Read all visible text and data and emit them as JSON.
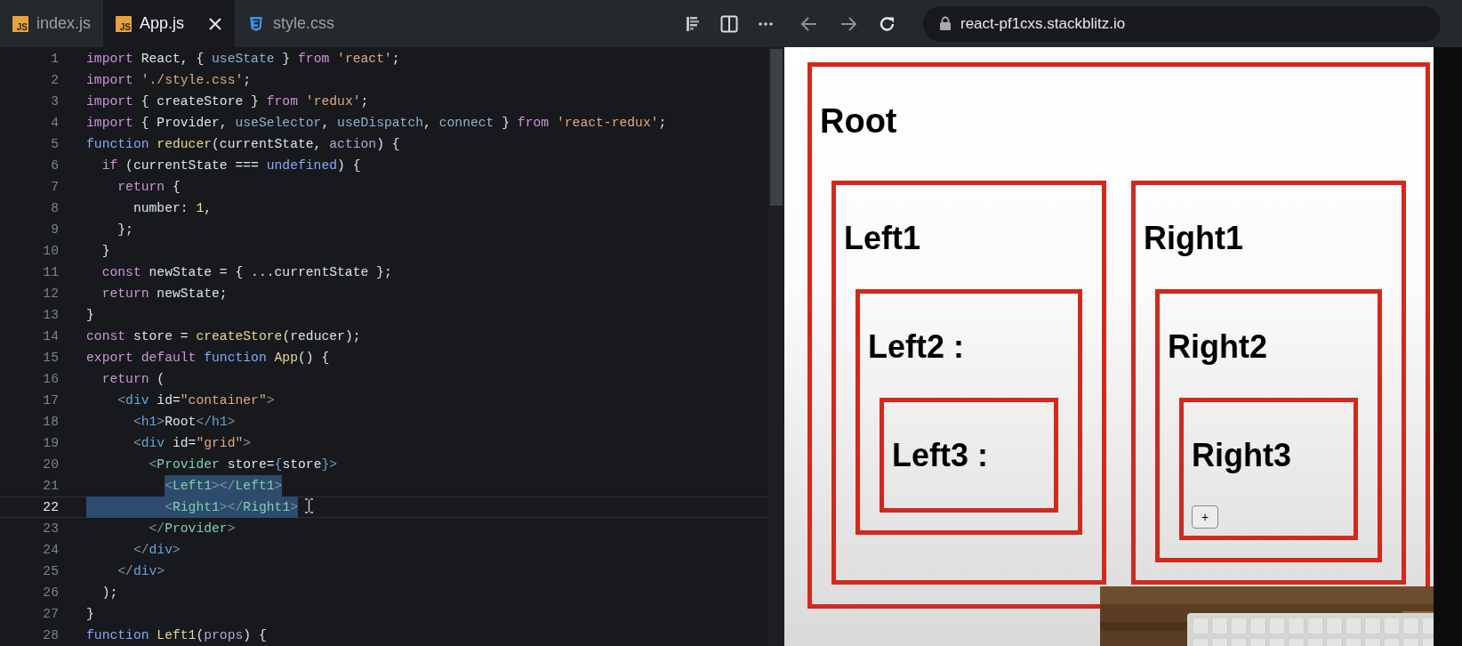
{
  "editor": {
    "tabs": [
      {
        "label": "index.js",
        "kind": "js",
        "badge": "JS",
        "selected": false
      },
      {
        "label": "App.js",
        "kind": "js",
        "badge": "JS",
        "selected": true
      },
      {
        "label": "style.css",
        "kind": "css",
        "selected": false
      }
    ],
    "lines": [
      {
        "number": "1",
        "selected": false,
        "current": false,
        "tokens": [
          {
            "text": "import",
            "kind": "keyword"
          },
          {
            "text": " React, { ",
            "kind": "plain"
          },
          {
            "text": "useState",
            "kind": "import"
          },
          {
            "text": " } ",
            "kind": "plain"
          },
          {
            "text": "from",
            "kind": "keyword"
          },
          {
            "text": " 'react'",
            "kind": "string"
          },
          {
            "text": ";",
            "kind": "plain"
          }
        ]
      },
      {
        "number": "2",
        "selected": false,
        "current": false,
        "tokens": [
          {
            "text": "import",
            "kind": "keyword"
          },
          {
            "text": " './style.css'",
            "kind": "string"
          },
          {
            "text": ";",
            "kind": "plain"
          }
        ]
      },
      {
        "number": "3",
        "selected": false,
        "current": false,
        "tokens": [
          {
            "text": "import",
            "kind": "keyword"
          },
          {
            "text": " { createStore } ",
            "kind": "plain"
          },
          {
            "text": "from",
            "kind": "keyword"
          },
          {
            "text": " 'redux'",
            "kind": "string"
          },
          {
            "text": ";",
            "kind": "plain"
          }
        ]
      },
      {
        "number": "4",
        "selected": false,
        "current": false,
        "tokens": [
          {
            "text": "import",
            "kind": "keyword"
          },
          {
            "text": " { Provider, ",
            "kind": "plain"
          },
          {
            "text": "useSelector",
            "kind": "import"
          },
          {
            "text": ", ",
            "kind": "plain"
          },
          {
            "text": "useDispatch",
            "kind": "import"
          },
          {
            "text": ", ",
            "kind": "plain"
          },
          {
            "text": "connect",
            "kind": "import"
          },
          {
            "text": " } ",
            "kind": "plain"
          },
          {
            "text": "from",
            "kind": "keyword"
          },
          {
            "text": " 'react-redux'",
            "kind": "string"
          },
          {
            "text": ";",
            "kind": "plain"
          }
        ]
      },
      {
        "number": "5",
        "selected": false,
        "current": false,
        "tokens": [
          {
            "text": "function",
            "kind": "storage"
          },
          {
            "text": " reducer",
            "kind": "func"
          },
          {
            "text": "(currentState, ",
            "kind": "plain"
          },
          {
            "text": "action",
            "kind": "param"
          },
          {
            "text": ") {",
            "kind": "plain"
          }
        ]
      },
      {
        "number": "6",
        "selected": false,
        "current": false,
        "tokens": [
          {
            "text": "  if",
            "kind": "keyword"
          },
          {
            "text": " (currentState === ",
            "kind": "plain"
          },
          {
            "text": "undefined",
            "kind": "constant"
          },
          {
            "text": ") {",
            "kind": "plain"
          }
        ]
      },
      {
        "number": "7",
        "selected": false,
        "current": false,
        "tokens": [
          {
            "text": "    return",
            "kind": "keyword"
          },
          {
            "text": " {",
            "kind": "plain"
          }
        ]
      },
      {
        "number": "8",
        "selected": false,
        "current": false,
        "tokens": [
          {
            "text": "      number: ",
            "kind": "plain"
          },
          {
            "text": "1",
            "kind": "number"
          },
          {
            "text": ",",
            "kind": "plain"
          }
        ]
      },
      {
        "number": "9",
        "selected": false,
        "current": false,
        "tokens": [
          {
            "text": "    };",
            "kind": "plain"
          }
        ]
      },
      {
        "number": "10",
        "selected": false,
        "current": false,
        "tokens": [
          {
            "text": "  }",
            "kind": "plain"
          }
        ]
      },
      {
        "number": "11",
        "selected": false,
        "current": false,
        "tokens": [
          {
            "text": "  const",
            "kind": "keyword"
          },
          {
            "text": " newState = { ...currentState };",
            "kind": "plain"
          }
        ]
      },
      {
        "number": "12",
        "selected": false,
        "current": false,
        "tokens": [
          {
            "text": "  return",
            "kind": "keyword"
          },
          {
            "text": " newState;",
            "kind": "plain"
          }
        ]
      },
      {
        "number": "13",
        "selected": false,
        "current": false,
        "tokens": [
          {
            "text": "}",
            "kind": "plain"
          }
        ]
      },
      {
        "number": "14",
        "selected": false,
        "current": false,
        "tokens": [
          {
            "text": "const",
            "kind": "keyword"
          },
          {
            "text": " store = ",
            "kind": "plain"
          },
          {
            "text": "createStore",
            "kind": "func"
          },
          {
            "text": "(reducer);",
            "kind": "plain"
          }
        ]
      },
      {
        "number": "15",
        "selected": false,
        "current": false,
        "tokens": [
          {
            "text": "export default",
            "kind": "keyword"
          },
          {
            "text": " function",
            "kind": "storage"
          },
          {
            "text": " App",
            "kind": "func"
          },
          {
            "text": "() {",
            "kind": "plain"
          }
        ]
      },
      {
        "number": "16",
        "selected": false,
        "current": false,
        "tokens": [
          {
            "text": "  return",
            "kind": "keyword"
          },
          {
            "text": " (",
            "kind": "plain"
          }
        ]
      },
      {
        "number": "17",
        "selected": false,
        "current": false,
        "tokens": [
          {
            "text": "    <",
            "kind": "tagpunct"
          },
          {
            "text": "div",
            "kind": "htmltag"
          },
          {
            "text": " id=",
            "kind": "plain"
          },
          {
            "text": "\"container\"",
            "kind": "string"
          },
          {
            "text": ">",
            "kind": "tagpunct"
          }
        ]
      },
      {
        "number": "18",
        "selected": false,
        "current": false,
        "tokens": [
          {
            "text": "      <",
            "kind": "tagpunct"
          },
          {
            "text": "h1",
            "kind": "htmltag"
          },
          {
            "text": ">",
            "kind": "tagpunct"
          },
          {
            "text": "Root",
            "kind": "plain"
          },
          {
            "text": "</",
            "kind": "tagpunct"
          },
          {
            "text": "h1",
            "kind": "htmltag"
          },
          {
            "text": ">",
            "kind": "tagpunct"
          }
        ]
      },
      {
        "number": "19",
        "selected": false,
        "current": false,
        "tokens": [
          {
            "text": "      <",
            "kind": "tagpunct"
          },
          {
            "text": "div",
            "kind": "htmltag"
          },
          {
            "text": " id=",
            "kind": "plain"
          },
          {
            "text": "\"grid\"",
            "kind": "string"
          },
          {
            "text": ">",
            "kind": "tagpunct"
          }
        ]
      },
      {
        "number": "20",
        "selected": false,
        "current": false,
        "tokens": [
          {
            "text": "        <",
            "kind": "tagpunct"
          },
          {
            "text": "Provider",
            "kind": "component"
          },
          {
            "text": " store=",
            "kind": "plain"
          },
          {
            "text": "{",
            "kind": "htmltag"
          },
          {
            "text": "store",
            "kind": "plain"
          },
          {
            "text": "}",
            "kind": "htmltag"
          },
          {
            "text": ">",
            "kind": "tagpunct"
          }
        ]
      },
      {
        "number": "21",
        "selected": true,
        "current": false,
        "tokens": [
          {
            "text": "          <",
            "kind": "tagpunct"
          },
          {
            "text": "Left1",
            "kind": "component"
          },
          {
            "text": "></",
            "kind": "tagpunct"
          },
          {
            "text": "Left1",
            "kind": "component"
          },
          {
            "text": ">",
            "kind": "tagpunct"
          }
        ]
      },
      {
        "number": "22",
        "selected": true,
        "current": true,
        "tokens": [
          {
            "text": "          <",
            "kind": "tagpunct"
          },
          {
            "text": "Right1",
            "kind": "component"
          },
          {
            "text": "></",
            "kind": "tagpunct"
          },
          {
            "text": "Right1",
            "kind": "component"
          },
          {
            "text": ">",
            "kind": "tagpunct"
          }
        ]
      },
      {
        "number": "23",
        "selected": false,
        "current": false,
        "tokens": [
          {
            "text": "        </",
            "kind": "tagpunct"
          },
          {
            "text": "Provider",
            "kind": "component"
          },
          {
            "text": ">",
            "kind": "tagpunct"
          }
        ]
      },
      {
        "number": "24",
        "selected": false,
        "current": false,
        "tokens": [
          {
            "text": "      </",
            "kind": "tagpunct"
          },
          {
            "text": "div",
            "kind": "htmltag"
          },
          {
            "text": ">",
            "kind": "tagpunct"
          }
        ]
      },
      {
        "number": "25",
        "selected": false,
        "current": false,
        "tokens": [
          {
            "text": "    </",
            "kind": "tagpunct"
          },
          {
            "text": "div",
            "kind": "htmltag"
          },
          {
            "text": ">",
            "kind": "tagpunct"
          }
        ]
      },
      {
        "number": "26",
        "selected": false,
        "current": false,
        "tokens": [
          {
            "text": "  );",
            "kind": "plain"
          }
        ]
      },
      {
        "number": "27",
        "selected": false,
        "current": false,
        "tokens": [
          {
            "text": "}",
            "kind": "plain"
          }
        ]
      },
      {
        "number": "28",
        "selected": false,
        "current": false,
        "tokens": [
          {
            "text": "function",
            "kind": "storage"
          },
          {
            "text": " Left1",
            "kind": "func"
          },
          {
            "text": "(",
            "kind": "plain"
          },
          {
            "text": "props",
            "kind": "param"
          },
          {
            "text": ") {",
            "kind": "plain"
          }
        ]
      }
    ]
  },
  "browser": {
    "url": "react-pf1cxs.stackblitz.io"
  },
  "preview": {
    "heading": "Root",
    "panels": [
      {
        "title": "Left1",
        "children": [
          {
            "title": "Left2 :",
            "children": [
              {
                "title": "Left3 :"
              }
            ]
          }
        ]
      },
      {
        "title": "Right1",
        "children": [
          {
            "title": "Right2",
            "children": [
              {
                "title": "Right3",
                "button": "+"
              }
            ]
          }
        ]
      }
    ]
  }
}
